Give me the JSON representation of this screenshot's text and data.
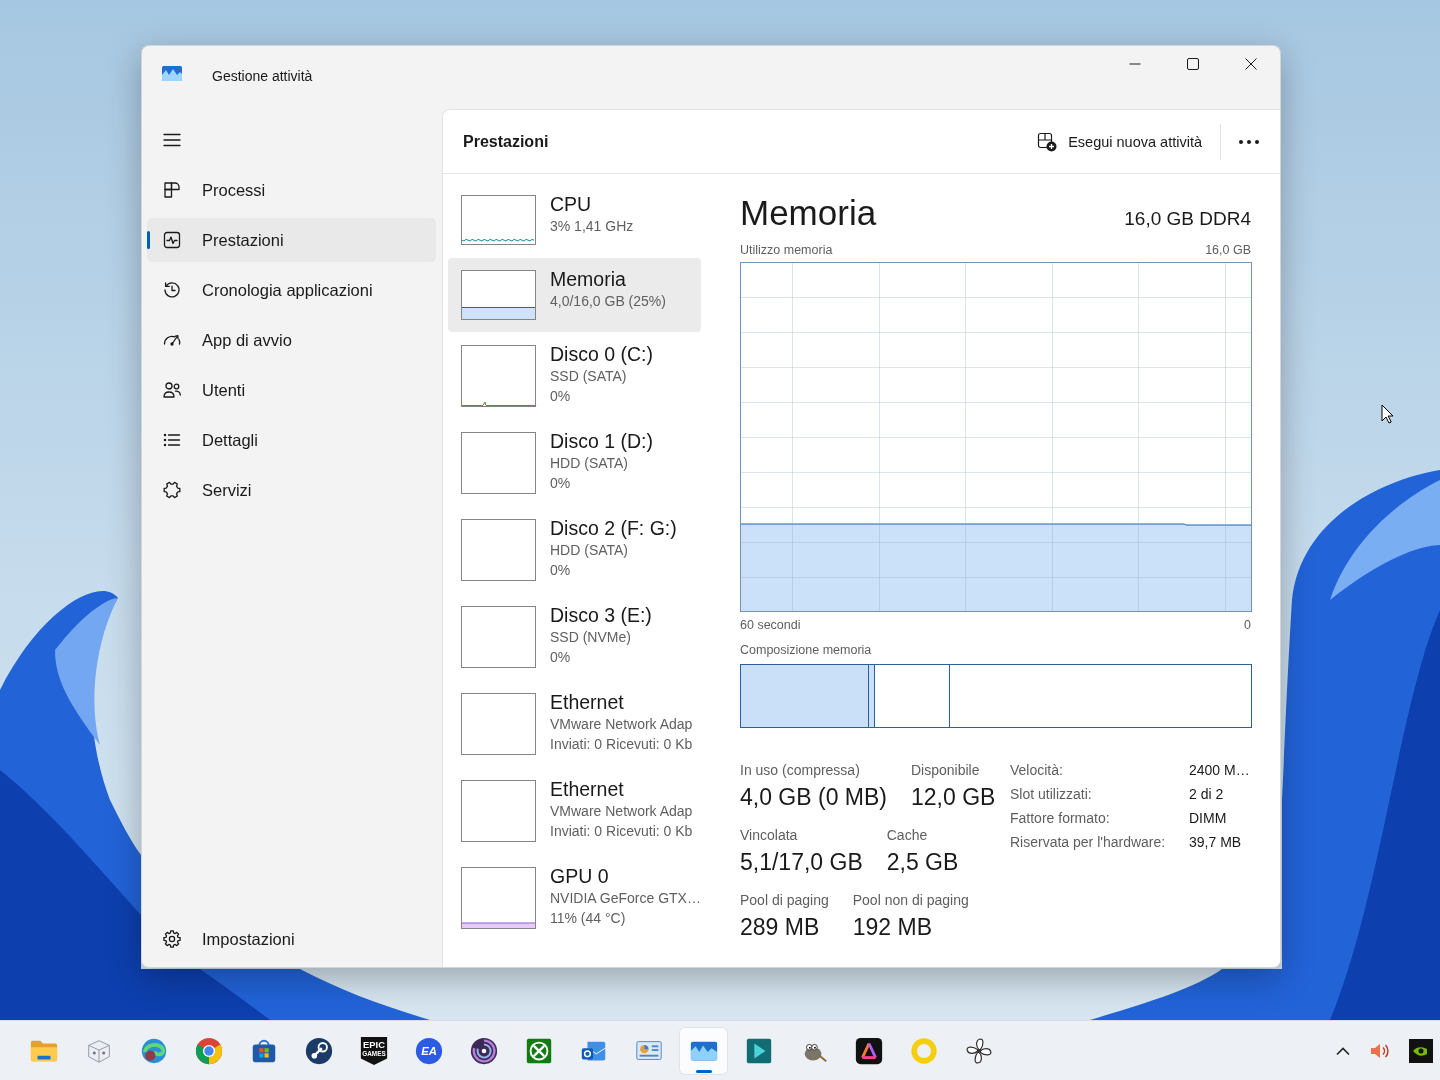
{
  "window": {
    "title": "Gestione attività"
  },
  "sidebar": {
    "items": [
      {
        "kind": "processes",
        "label": "Processi",
        "selected": false
      },
      {
        "kind": "performance",
        "label": "Prestazioni",
        "selected": true
      },
      {
        "kind": "history",
        "label": "Cronologia applicazioni",
        "selected": false
      },
      {
        "kind": "startup",
        "label": "App di avvio",
        "selected": false
      },
      {
        "kind": "users",
        "label": "Utenti",
        "selected": false
      },
      {
        "kind": "details",
        "label": "Dettagli",
        "selected": false
      },
      {
        "kind": "services",
        "label": "Servizi",
        "selected": false
      }
    ],
    "footer": {
      "label": "Impostazioni"
    }
  },
  "header": {
    "title": "Prestazioni",
    "action": "Esegui nuova attività"
  },
  "devices": [
    {
      "kind": "cpu",
      "name": "CPU",
      "details": [
        "3% 1,41 GHz"
      ],
      "selected": false
    },
    {
      "kind": "memory",
      "name": "Memoria",
      "details": [
        "4,0/16,0 GB (25%)"
      ],
      "selected": true
    },
    {
      "kind": "disk_active",
      "name": "Disco 0 (C:)",
      "details": [
        "SSD (SATA)",
        "0%"
      ],
      "selected": false
    },
    {
      "kind": "disk",
      "name": "Disco 1 (D:)",
      "details": [
        "HDD (SATA)",
        "0%"
      ],
      "selected": false
    },
    {
      "kind": "disk",
      "name": "Disco 2 (F: G:)",
      "details": [
        "HDD (SATA)",
        "0%"
      ],
      "selected": false
    },
    {
      "kind": "disk",
      "name": "Disco 3 (E:)",
      "details": [
        "SSD (NVMe)",
        "0%"
      ],
      "selected": false
    },
    {
      "kind": "ethernet",
      "name": "Ethernet",
      "details": [
        "VMware Network Adap",
        "Inviati: 0 Ricevuti: 0 Kb"
      ],
      "selected": false
    },
    {
      "kind": "ethernet",
      "name": "Ethernet",
      "details": [
        "VMware Network Adap",
        "Inviati: 0 Ricevuti: 0 Kb"
      ],
      "selected": false
    },
    {
      "kind": "gpu",
      "name": "GPU 0",
      "details": [
        "NVIDIA GeForce GTX…",
        "11% (44 °C)"
      ],
      "selected": false
    }
  ],
  "detail": {
    "title": "Memoria",
    "spec": "16,0 GB DDR4",
    "graph": {
      "label": "Utilizzo memoria",
      "max": "16,0 GB",
      "start": "60 secondi",
      "end": "0"
    },
    "composition": {
      "label": "Composizione memoria"
    },
    "stats": [
      [
        {
          "label": "In uso (compressa)",
          "value": "4,0 GB (0 MB)"
        },
        {
          "label": "Disponibile",
          "value": "12,0 GB"
        }
      ],
      [
        {
          "label": "Vincolata",
          "value": "5,1/17,0 GB"
        },
        {
          "label": "Cache",
          "value": "2,5 GB"
        }
      ],
      [
        {
          "label": "Pool di paging",
          "value": "289 MB"
        },
        {
          "label": "Pool non di paging",
          "value": "192 MB"
        }
      ]
    ],
    "properties": [
      {
        "label": "Velocità:",
        "value": "2400 M…"
      },
      {
        "label": "Slot utilizzati:",
        "value": "2 di 2"
      },
      {
        "label": "Fattore formato:",
        "value": "DIMM"
      },
      {
        "label": "Riservata per l'hardware:",
        "value": "39,7 MB"
      }
    ]
  },
  "taskbar": {
    "apps": [
      {
        "kind": "folder",
        "selected": false
      },
      {
        "kind": "cube",
        "selected": false
      },
      {
        "kind": "swirl",
        "selected": false
      },
      {
        "kind": "tricolor",
        "selected": false
      },
      {
        "kind": "bag",
        "selected": false
      },
      {
        "kind": "linkage",
        "selected": false
      },
      {
        "kind": "shield",
        "selected": false,
        "logo_text": [
          "EPIC",
          "GAMES"
        ]
      },
      {
        "kind": "lettered_disc",
        "selected": false,
        "logo_text": [
          "EA"
        ]
      },
      {
        "kind": "spiral",
        "selected": false
      },
      {
        "kind": "sphere_x",
        "selected": false
      },
      {
        "kind": "envelope",
        "selected": false
      },
      {
        "kind": "dashboard",
        "selected": false
      },
      {
        "kind": "wave_chart",
        "selected": true
      },
      {
        "kind": "play_tile",
        "selected": false
      },
      {
        "kind": "mascot",
        "selected": false
      },
      {
        "kind": "triangle",
        "selected": false
      },
      {
        "kind": "ring",
        "selected": false
      },
      {
        "kind": "fan",
        "selected": false
      }
    ]
  }
}
